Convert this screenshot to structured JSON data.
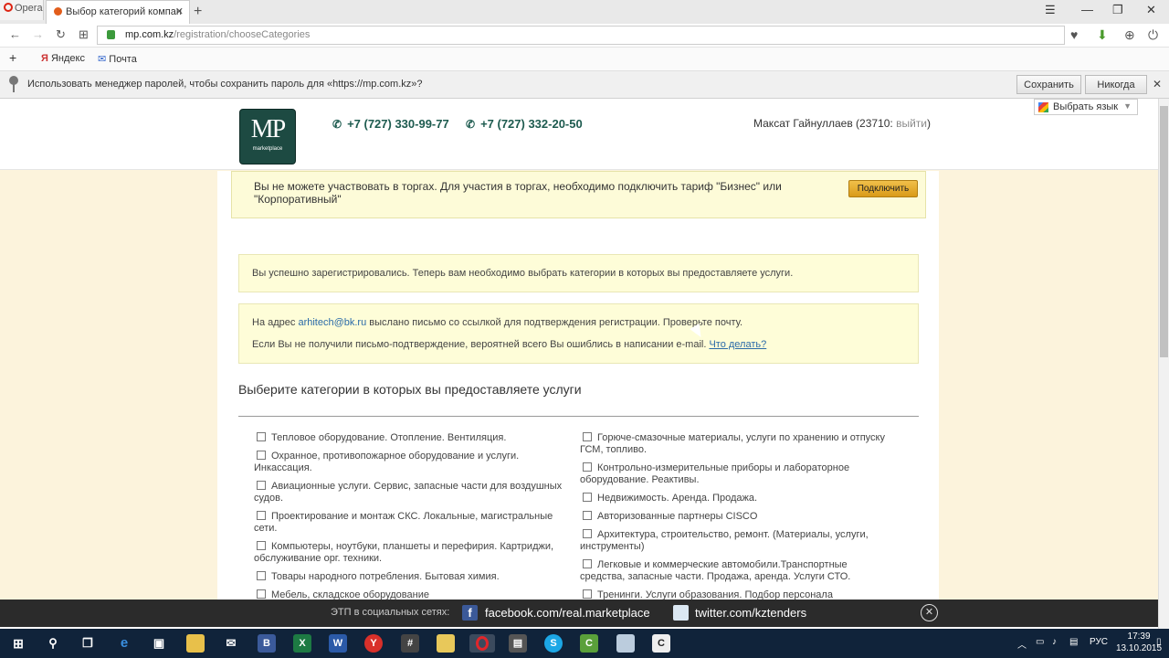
{
  "browser": {
    "menu_label": "Opera",
    "tab_title": "Выбор категорий компан",
    "url_host": "mp.com.kz",
    "url_path": "/registration/chooseCategories",
    "bookmarks": [
      "Яндекс",
      "Почта"
    ],
    "password_bar": {
      "text": "Использовать менеджер паролей, чтобы сохранить пароль для «https://mp.com.kz»?",
      "save_label": "Сохранить",
      "never_label": "Никогда"
    }
  },
  "header": {
    "logo_text": "MP",
    "logo_subtext": "marketplace",
    "phones": [
      "+7 (727) 330-99-77",
      "+7 (727) 332-20-50"
    ],
    "user_name": "Максат Гайнуллаев (23710: ",
    "logout_label": "выйти",
    "user_suffix": ")",
    "language_label": "Выбрать язык"
  },
  "notice": {
    "text": "Вы не можете участвовать в торгах. Для участия в торгах, необходимо подключить тариф \"Бизнес\" или \"Корпоративный\"",
    "button_label": "Подключить"
  },
  "messages": {
    "registered": "Вы успешно зарегистрировались. Теперь вам необходимо выбрать категории в которых вы предоставляете услуги.",
    "email_prefix": "На адрес ",
    "email": "arhitech@bk.ru",
    "email_suffix": " выслано письмо со ссылкой для подтверждения регистрации. Проверьте почту.",
    "not_received": "Если Вы не получили письмо-подтверждение, вероятней всего Вы ошиблись в написании e-mail. ",
    "what_to_do": "Что делать?"
  },
  "categories": {
    "title": "Выберите категории в которых вы предоставляете услуги",
    "left": [
      "Тепловое оборудование. Отопление. Вентиляция.",
      "Охранное, противопожарное оборудование и услуги. Инкассация.",
      "Авиационные услуги. Сервис, запасные части для воздушных судов.",
      "Проектирование и монтаж СКС. Локальные, магистральные сети.",
      "Компьютеры, ноутбуки, планшеты и перефирия. Картриджи, обслуживание орг. техники.",
      "Товары народного потребления. Бытовая химия.",
      "Мебель, складское оборудование"
    ],
    "right": [
      "Горюче-смазочные материалы, услуги по хранению и отпуску ГСМ, топливо.",
      "Контрольно-измерительные приборы и лабораторное оборудование. Реактивы.",
      "Недвижимость. Аренда. Продажа.",
      "Авторизованные партнеры CISCO",
      "Архитектура, строительство, ремонт. (Материалы, услуги, инструменты)",
      "Легковые и коммерческие автомобили.Транспортные средства, запасные части. Продажа, аренда. Услуги СТО.",
      "Тренинги. Услуги образования. Подбор персонала"
    ]
  },
  "social": {
    "label": "ЭТП в социальных сетях:",
    "facebook": "facebook.com/real.marketplace",
    "twitter": "twitter.com/kztenders"
  },
  "taskbar": {
    "apps": [
      "start-icon",
      "search-icon",
      "task-view-icon",
      "edge-icon",
      "store-icon",
      "explorer-icon",
      "mail-icon",
      "app-b-icon",
      "excel-icon",
      "word-icon",
      "yandex-icon",
      "calculator-icon",
      "folder-icon",
      "opera-icon",
      "media-icon",
      "skype-icon",
      "green-app-icon",
      "notes-icon",
      "app-c-icon"
    ],
    "lang": "РУС",
    "time": "17:39",
    "date": "13.10.2015"
  }
}
